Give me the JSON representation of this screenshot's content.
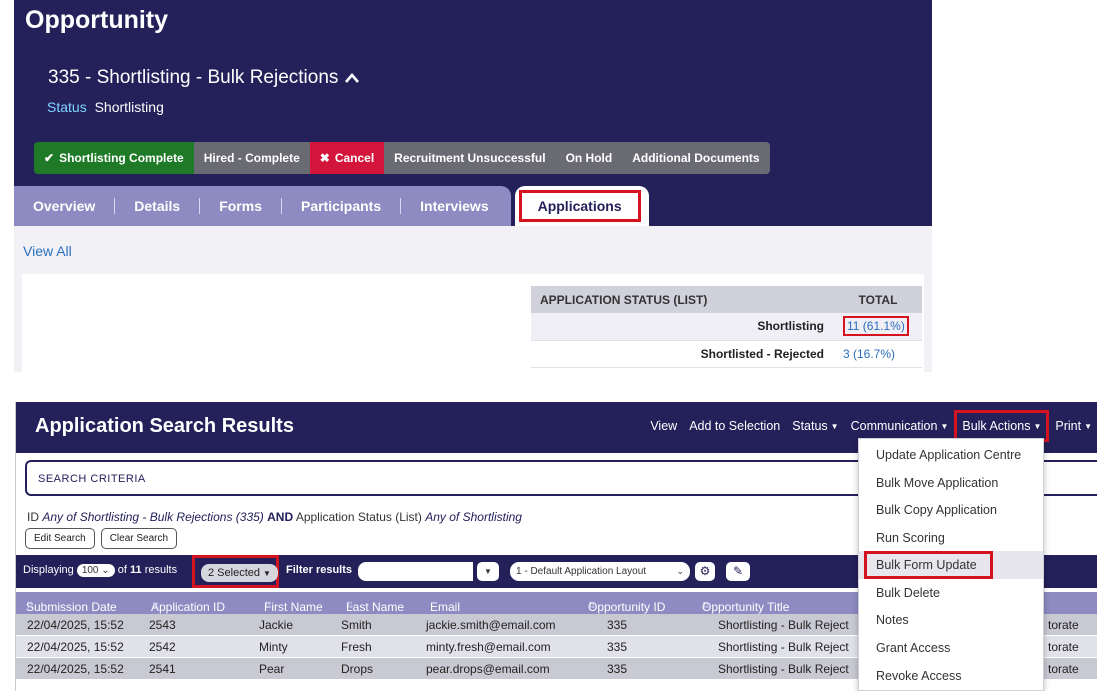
{
  "opportunity": {
    "heading": "Opportunity",
    "subtitle": "335 - Shortlisting - Bulk Rejections",
    "status_label": "Status",
    "status_value": "Shortlisting",
    "buttons": [
      {
        "label": "Shortlisting Complete",
        "icon": "check-icon",
        "color": "#1f7a27"
      },
      {
        "label": "Hired - Complete"
      },
      {
        "label": "Cancel",
        "icon": "cross-icon",
        "color": "#d3143b"
      },
      {
        "label": "Recruitment Unsuccessful"
      },
      {
        "label": "On Hold"
      },
      {
        "label": "Additional Documents"
      }
    ],
    "tabs": [
      "Overview",
      "Details",
      "Forms",
      "Participants",
      "Interviews"
    ],
    "active_tab": "Applications",
    "view_all": "View All",
    "status_table": {
      "headers": [
        "APPLICATION STATUS (LIST)",
        "TOTAL"
      ],
      "rows": [
        {
          "status": "Shortlisting",
          "total": "11 (61.1%)"
        },
        {
          "status": "Shortlisted - Rejected",
          "total": "3 (16.7%)"
        }
      ]
    }
  },
  "results": {
    "title": "Application Search Results",
    "menu": [
      "View",
      "Add to Selection",
      "Status",
      "Communication",
      "Bulk Actions",
      "Print"
    ],
    "search_criteria_label": "SEARCH CRITERIA",
    "criteria": {
      "id_label": "ID",
      "any_of_1": "Any of",
      "value_1": "Shortlisting - Bulk Rejections (335)",
      "and": "AND",
      "field_2": "Application Status (List)",
      "any_of_2": "Any of",
      "value_2": "Shortlisting"
    },
    "edit_search": "Edit Search",
    "clear_search": "Clear Search",
    "displaying": "Displaying",
    "page_size": "100",
    "of_results": "of",
    "result_count": "11",
    "results_word": "results",
    "selected": "2 Selected",
    "filter_label": "Filter results",
    "layout": "1 - Default Application Layout",
    "columns": [
      "Submission Date",
      "Application ID",
      "First Name",
      "Last Name",
      "Email",
      "Opportunity ID",
      "Opportunity Title"
    ],
    "rows": [
      {
        "date": "22/04/2025, 15:52",
        "id": "2543",
        "first": "Jackie",
        "last": "Smith",
        "email": "jackie.smith@email.com",
        "opp_id": "335",
        "title": "Shortlisting - Bulk Reject",
        "extra": "torate"
      },
      {
        "date": "22/04/2025, 15:52",
        "id": "2542",
        "first": "Minty",
        "last": "Fresh",
        "email": "minty.fresh@email.com",
        "opp_id": "335",
        "title": "Shortlisting - Bulk Reject",
        "extra": "torate"
      },
      {
        "date": "22/04/2025, 15:52",
        "id": "2541",
        "first": "Pear",
        "last": "Drops",
        "email": "pear.drops@email.com",
        "opp_id": "335",
        "title": "Shortlisting - Bulk Reject",
        "extra": "torate"
      }
    ]
  },
  "bulk_actions_menu": [
    "Update Application Centre",
    "Bulk Move Application",
    "Bulk Copy Application",
    "Run Scoring",
    "Bulk Form Update",
    "Bulk Delete",
    "Notes",
    "Grant Access",
    "Revoke Access"
  ],
  "colors": {
    "navy": "#24205a",
    "tab_purple": "#8d8bc1",
    "highlight_red": "#d5121f",
    "link_blue": "#2a6ebb"
  }
}
